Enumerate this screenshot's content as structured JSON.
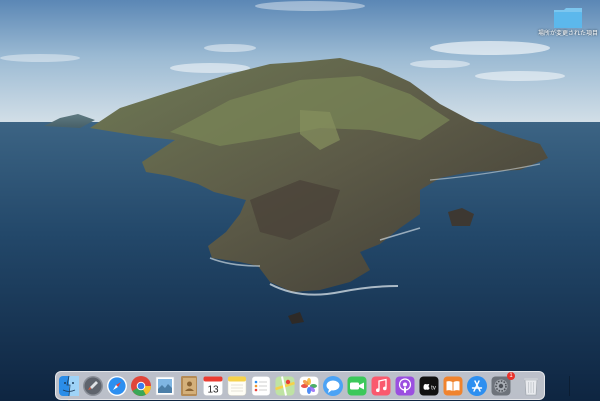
{
  "desktop": {
    "folder": {
      "label": "場所が変更された項目",
      "icon": "folder-icon",
      "color": "#5cb8ec"
    }
  },
  "dock": {
    "items": [
      {
        "name": "finder",
        "icon": "finder-icon",
        "running": true
      },
      {
        "name": "launchpad",
        "icon": "launchpad-rocket-icon",
        "running": false
      },
      {
        "name": "safari",
        "icon": "safari-compass-icon",
        "running": false
      },
      {
        "name": "chrome",
        "icon": "chrome-icon",
        "running": false
      },
      {
        "name": "mail",
        "icon": "mail-stamp-icon",
        "running": false
      },
      {
        "name": "contacts",
        "icon": "contacts-book-icon",
        "running": false
      },
      {
        "name": "calendar",
        "icon": "calendar-icon",
        "day": "13",
        "running": false
      },
      {
        "name": "notes",
        "icon": "notes-icon",
        "running": false
      },
      {
        "name": "reminders",
        "icon": "reminders-icon",
        "running": false
      },
      {
        "name": "maps",
        "icon": "maps-icon",
        "running": false
      },
      {
        "name": "photos",
        "icon": "photos-flower-icon",
        "running": false
      },
      {
        "name": "messages",
        "icon": "messages-bubble-icon",
        "running": false
      },
      {
        "name": "facetime",
        "icon": "facetime-camera-icon",
        "running": false
      },
      {
        "name": "music",
        "icon": "music-note-icon",
        "running": false
      },
      {
        "name": "podcasts",
        "icon": "podcasts-icon",
        "running": false
      },
      {
        "name": "tv",
        "icon": "apple-tv-icon",
        "label": "tv",
        "running": false
      },
      {
        "name": "books",
        "icon": "books-icon",
        "running": false
      },
      {
        "name": "app-store",
        "icon": "app-store-icon",
        "running": false
      },
      {
        "name": "system-preferences",
        "icon": "gear-icon",
        "badge": "1",
        "running": false
      },
      {
        "name": "trash",
        "icon": "trash-icon",
        "running": false
      }
    ]
  }
}
